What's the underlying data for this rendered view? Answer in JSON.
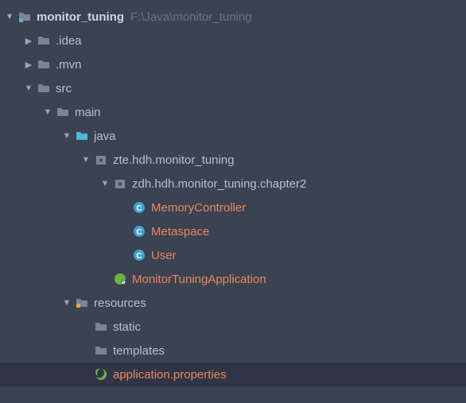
{
  "root": {
    "name": "monitor_tuning",
    "path": "F:\\Java\\monitor_tuning"
  },
  "nodes": {
    "idea": ".idea",
    "mvn": ".mvn",
    "src": "src",
    "main": "main",
    "java": "java",
    "pkg1": "zte.hdh.monitor_tuning",
    "pkg2": "zdh.hdh.monitor_tuning.chapter2",
    "memctrl": "MemoryController",
    "metaspace": "Metaspace",
    "user": "User",
    "app": "MonitorTuningApplication",
    "resources": "resources",
    "static": "static",
    "templates": "templates",
    "appprops": "application.properties"
  }
}
